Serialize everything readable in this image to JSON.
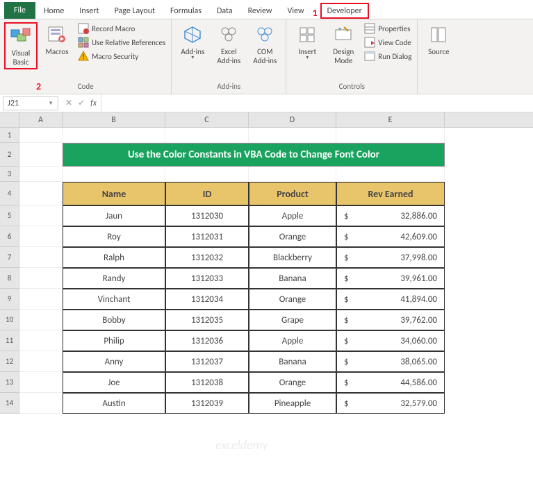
{
  "tabs": {
    "file": "File",
    "home": "Home",
    "insert": "Insert",
    "pagelayout": "Page Layout",
    "formulas": "Formulas",
    "data": "Data",
    "review": "Review",
    "view": "View",
    "developer": "Developer"
  },
  "annot": {
    "one": "1",
    "two": "2"
  },
  "ribbon": {
    "code": {
      "label": "Code",
      "visual_basic": "Visual Basic",
      "macros": "Macros",
      "record_macro": "Record Macro",
      "use_relative": "Use Relative References",
      "macro_security": "Macro Security"
    },
    "addins": {
      "label": "Add-ins",
      "addins": "Add-ins",
      "excel_addins": "Excel Add-ins",
      "com_addins": "COM Add-ins"
    },
    "controls": {
      "label": "Controls",
      "insert": "Insert",
      "design_mode": "Design Mode",
      "properties": "Properties",
      "view_code": "View Code",
      "run_dialog": "Run Dialog"
    },
    "xml": {
      "source": "Source"
    }
  },
  "formula_bar": {
    "name_box": "J21",
    "fx": "fx",
    "formula": ""
  },
  "columns": [
    "A",
    "B",
    "C",
    "D",
    "E"
  ],
  "row_numbers": [
    "1",
    "2",
    "3",
    "4",
    "5",
    "6",
    "7",
    "8",
    "9",
    "10",
    "11",
    "12",
    "13",
    "14"
  ],
  "title": "Use the Color Constants in VBA Code to Change Font Color",
  "table": {
    "headers": {
      "name": "Name",
      "id": "ID",
      "product": "Product",
      "rev": "Rev Earned"
    },
    "rows": [
      {
        "name": "Jaun",
        "id": "1312030",
        "product": "Apple",
        "rev": "32,886.00"
      },
      {
        "name": "Roy",
        "id": "1312031",
        "product": "Orange",
        "rev": "42,609.00"
      },
      {
        "name": "Ralph",
        "id": "1312032",
        "product": "Blackberry",
        "rev": "37,998.00"
      },
      {
        "name": "Randy",
        "id": "1312033",
        "product": "Banana",
        "rev": "39,961.00"
      },
      {
        "name": "Vinchant",
        "id": "1312034",
        "product": "Orange",
        "rev": "41,894.00"
      },
      {
        "name": "Bobby",
        "id": "1312035",
        "product": "Grape",
        "rev": "39,762.00"
      },
      {
        "name": "Philip",
        "id": "1312036",
        "product": "Apple",
        "rev": "34,060.00"
      },
      {
        "name": "Anny",
        "id": "1312037",
        "product": "Banana",
        "rev": "38,065.00"
      },
      {
        "name": "Joe",
        "id": "1312038",
        "product": "Orange",
        "rev": "44,586.00"
      },
      {
        "name": "Austin",
        "id": "1312039",
        "product": "Pineapple",
        "rev": "32,579.00"
      }
    ],
    "currency": "$"
  },
  "watermark": "exceldemy"
}
